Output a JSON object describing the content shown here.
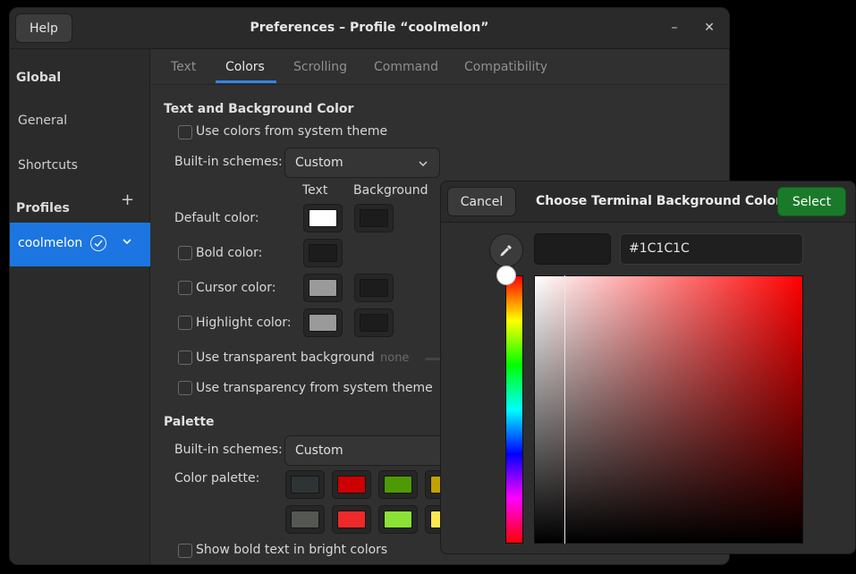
{
  "window": {
    "title": "Preferences – Profile “coolmelon”",
    "help_label": "Help",
    "minimize_glyph": "–",
    "close_glyph": "✕"
  },
  "sidebar": {
    "global_heading": "Global",
    "items": [
      {
        "label": "General"
      },
      {
        "label": "Shortcuts"
      }
    ],
    "profiles_heading": "Profiles",
    "add_glyph": "+",
    "selected_profile": "coolmelon"
  },
  "tabs": [
    {
      "label": "Text"
    },
    {
      "label": "Colors"
    },
    {
      "label": "Scrolling"
    },
    {
      "label": "Command"
    },
    {
      "label": "Compatibility"
    }
  ],
  "active_tab": "Colors",
  "text_bg": {
    "heading": "Text and Background Color",
    "system_theme_label": "Use colors from system theme",
    "builtin_label": "Built-in schemes:",
    "builtin_value": "Custom",
    "col_text": "Text",
    "col_background": "Background",
    "default_color_label": "Default color:",
    "bold_color_label": "Bold color:",
    "cursor_color_label": "Cursor color:",
    "highlight_color_label": "Highlight color:",
    "transparent_label": "Use transparent background",
    "transparent_value": "none",
    "transparency_system_label": "Use transparency from system theme",
    "colors": {
      "default_text": "#ffffff",
      "default_bg": "#1c1c1c",
      "bold": "#1c1c1c",
      "cursor_text": "#9a9a9a",
      "cursor_bg": "#1c1c1c",
      "highlight_text": "#9a9a9a",
      "highlight_bg": "#1c1c1c"
    }
  },
  "palette": {
    "heading": "Palette",
    "builtin_label": "Built-in schemes:",
    "builtin_value": "Custom",
    "color_palette_label": "Color palette:",
    "row1": [
      "#2e3436",
      "#cc0000",
      "#4e9a06",
      "#c4a000"
    ],
    "row2": [
      "#555753",
      "#ef2929",
      "#8ae234",
      "#fce94f"
    ],
    "bold_bright_label": "Show bold text in bright colors"
  },
  "dialog": {
    "cancel_label": "Cancel",
    "title": "Choose Terminal Background Color",
    "select_label": "Select",
    "hex_value": "#1C1C1C",
    "preview_color": "#1c1c1c"
  }
}
